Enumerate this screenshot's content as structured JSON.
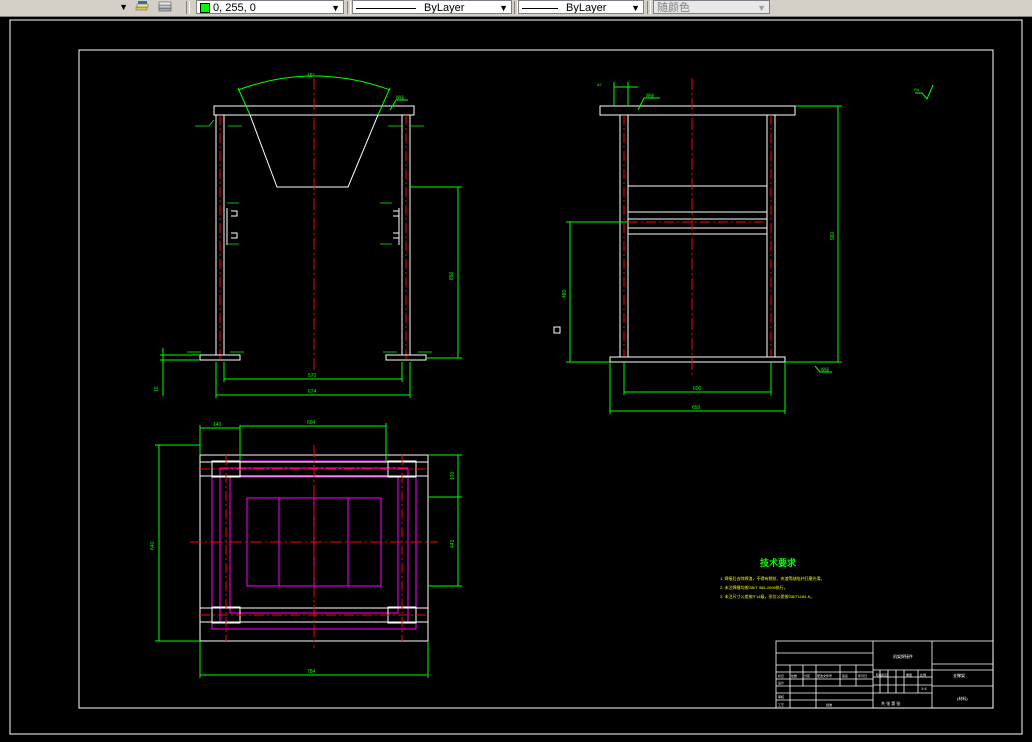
{
  "toolbar": {
    "layer_arrow": "▼",
    "color_value": "0, 255, 0",
    "linetype_value": "ByLayer",
    "lineweight_value": "ByLayer",
    "plotstyle_value": "随颜色",
    "dropdown_arrow": "▼"
  },
  "colors": {
    "background": "#000000",
    "geometry": "#ffffff",
    "dimension": "#00ff00",
    "centerline": "#ff0000",
    "hidden": "#ff00ff",
    "note_title": "#00ff00",
    "note_text": "#ffff00"
  },
  "drawing": {
    "front_view": {
      "angle_dim": "46°",
      "weld_label": "焊接",
      "height_dim": "850",
      "inner_width_dim": "570",
      "outer_width_dim": "674",
      "base_dim": "15"
    },
    "side_view": {
      "top_dim": "82",
      "weld_top": "焊接",
      "height_dim": "960",
      "mid_height_dim": "480",
      "inner_width_dim": "600",
      "outer_width_dim": "650",
      "foot_label": "焊接",
      "surface_mark": "Ra"
    },
    "top_view": {
      "left_dim": "140",
      "top_dim": "664",
      "right_top_dim": "170",
      "right_mid_dim": "442",
      "left_height_dim": "640",
      "bottom_width_dim": "784"
    },
    "notes": {
      "title": "技术要求",
      "lines": [
        "1. 焊接后去除焊渣，不得有裂纹、夹渣等缺陷并打磨光滑。",
        "2. 未注焊缝均按GB/T 985-2008执行。",
        "3. 未注尺寸公差按IT14级，形位公差按GB/T1184-K。"
      ]
    },
    "title_block": {
      "name": "机架焊接件",
      "drawing_code": "支撑架",
      "scale": "1:4",
      "material": "(材料)",
      "sheet_row": "共  张  第  张",
      "designer": "设计",
      "reviewer": "审核",
      "process": "工艺",
      "approve": "批准",
      "mark": "标记",
      "count": "处数",
      "zone": "分区",
      "change": "更改文件号",
      "sign": "签名",
      "date": "年月日",
      "stage": "阶段标记",
      "weight": "重量",
      "ratio": "比例"
    }
  }
}
